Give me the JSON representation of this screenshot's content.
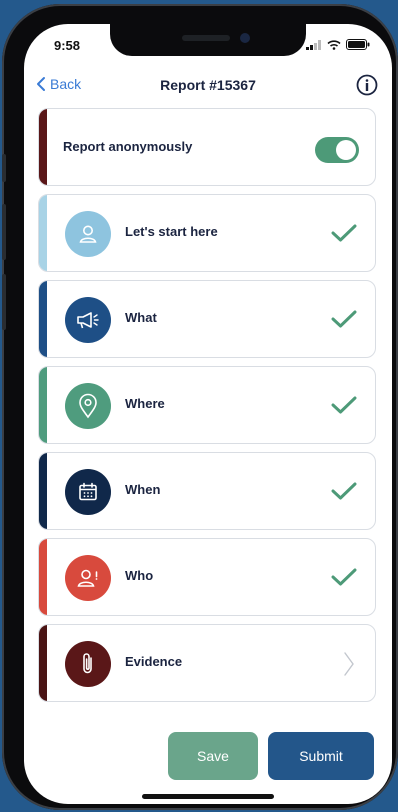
{
  "status": {
    "time": "9:58"
  },
  "nav": {
    "back_label": "Back",
    "title": "Report #15367"
  },
  "anonymous": {
    "label": "Report anonymously",
    "enabled": true
  },
  "sections": [
    {
      "label": "Let's start here",
      "icon": "person-icon",
      "color": "#a8d3e6",
      "avatar": "#8ec4df",
      "state": "complete"
    },
    {
      "label": "What",
      "icon": "megaphone-icon",
      "color": "#1e4f86",
      "avatar": "#1e4f86",
      "state": "complete"
    },
    {
      "label": "Where",
      "icon": "location-pin-icon",
      "color": "#4f9c7e",
      "avatar": "#4f9c7e",
      "state": "complete"
    },
    {
      "label": "When",
      "icon": "calendar-icon",
      "color": "#10284a",
      "avatar": "#10284a",
      "state": "complete"
    },
    {
      "label": "Who",
      "icon": "person-alert-icon",
      "color": "#d84a3d",
      "avatar": "#d84a3d",
      "state": "complete"
    },
    {
      "label": "Evidence",
      "icon": "paperclip-icon",
      "color": "#4a1414",
      "avatar": "#5a1718",
      "state": "incomplete"
    }
  ],
  "actions": {
    "save_label": "Save",
    "submit_label": "Submit"
  },
  "colors": {
    "check": "#4d9a78",
    "accent": "#3a7bd5",
    "background": "#24598c"
  }
}
